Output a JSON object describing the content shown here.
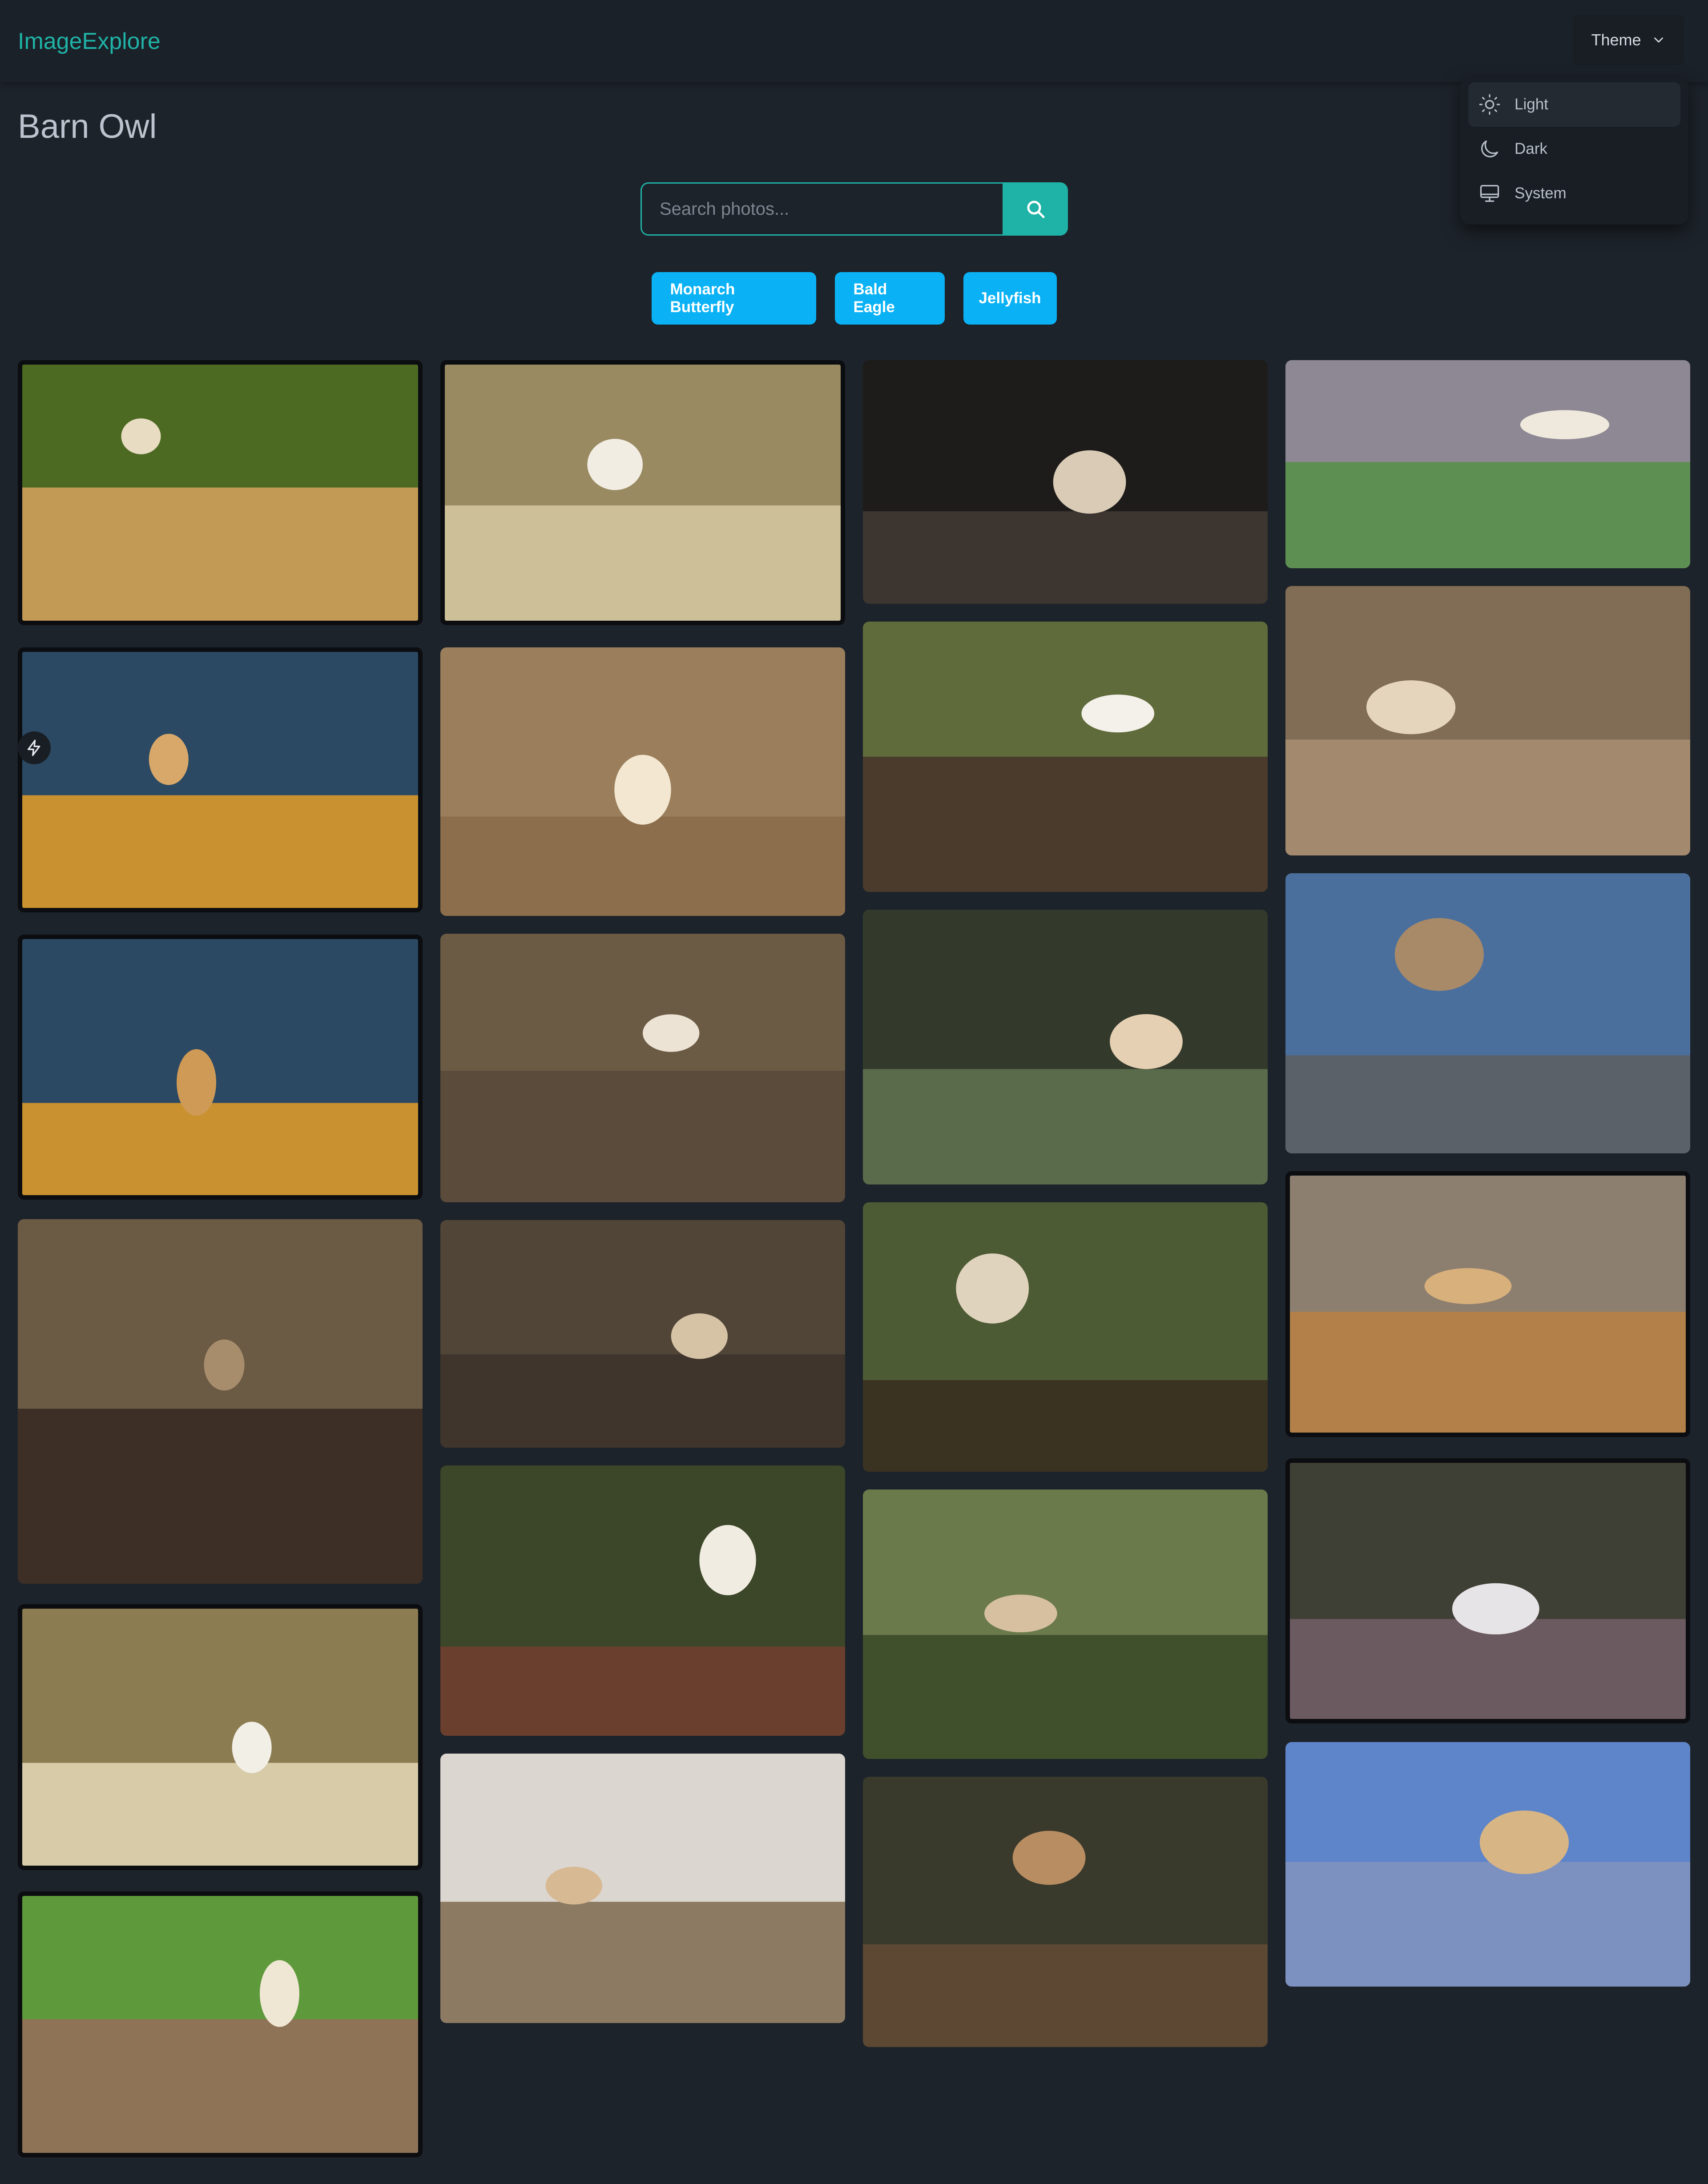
{
  "app": {
    "brand": "ImageExplore"
  },
  "theme_menu": {
    "button_label": "Theme",
    "items": [
      {
        "label": "Light",
        "icon": "sun-icon",
        "active": true
      },
      {
        "label": "Dark",
        "icon": "moon-icon",
        "active": false
      },
      {
        "label": "System",
        "icon": "monitor-icon",
        "active": false
      }
    ]
  },
  "page": {
    "title": "Barn Owl"
  },
  "search": {
    "placeholder": "Search photos...",
    "value": ""
  },
  "suggestions": [
    "Monarch Butterfly",
    "Bald Eagle",
    "Jellyfish"
  ],
  "colors": {
    "background": "#1d232a",
    "brand": "#1fb2a6",
    "tag": "#0ab2f5"
  },
  "gallery": {
    "photos": [
      {
        "subject": "barn-owl-over-golden-field",
        "sky": "#4d6a23",
        "ground": "#c29a55",
        "bird": "#e8dcc3"
      },
      {
        "subject": "barn-owl-over-pale-grass",
        "sky": "#9a8a62",
        "ground": "#cdbf98",
        "bird": "#f1ede3"
      },
      {
        "subject": "two-barn-owls-on-ledge",
        "sky": "#1e1c1b",
        "ground": "#3c3530",
        "bird": "#d9cbb6"
      },
      {
        "subject": "barn-owl-over-green-meadow",
        "sky": "#8d8893",
        "ground": "#5e8f52",
        "bird": "#efe8dc"
      },
      {
        "subject": "barn-owl-against-blue-sky",
        "sky": "#2b4963",
        "ground": "#c9912f",
        "bird": "#d8a86a"
      },
      {
        "subject": "barn-owl-wings-raised",
        "sky": "#9b7f5d",
        "ground": "#8c6e4c",
        "bird": "#f3e7d1"
      },
      {
        "subject": "barn-owl-close-up-perched",
        "sky": "#5f6b3a",
        "ground": "#4b3b2c",
        "bird": "#f4f0ea"
      },
      {
        "subject": "barn-owl-gliding-over-field",
        "sky": "#816c55",
        "ground": "#a38a6e",
        "bird": "#e6d5bd"
      },
      {
        "subject": "barn-owl-in-flight-blue-sky",
        "sky": "#2b4963",
        "ground": "#c9912f",
        "bird": "#cf9a55"
      },
      {
        "subject": "barn-owl-on-wire",
        "sky": "#6b5b45",
        "ground": "#5a4b3a",
        "bird": "#ece3d4"
      },
      {
        "subject": "barn-owl-low-flight-green",
        "sky": "#333a2c",
        "ground": "#5a6b4c",
        "bird": "#e6d0b3"
      },
      {
        "subject": "barred-owl-on-roof",
        "sky": "#4b6f9c",
        "ground": "#5a6168",
        "bird": "#a88a68"
      },
      {
        "subject": "barn-owl-in-autumn-tree",
        "sky": "#6b5a44",
        "ground": "#3d2f26",
        "bird": "#a88d6d"
      },
      {
        "subject": "barn-owl-hidden-in-branches",
        "sky": "#514538",
        "ground": "#3f352c",
        "bird": "#d6c3a6"
      },
      {
        "subject": "barn-owl-among-leaves",
        "sky": "#4d5b35",
        "ground": "#3b3322",
        "bird": "#e0d3be"
      },
      {
        "subject": "barn-owl-over-hedge",
        "sky": "#8c7f70",
        "ground": "#b3804a",
        "bird": "#d8b07c"
      },
      {
        "subject": "barn-owl-over-pale-meadow",
        "sky": "#8c7c52",
        "ground": "#d7cba8",
        "bird": "#f2efe7"
      },
      {
        "subject": "barn-owl-in-bushes",
        "sky": "#3c4628",
        "ground": "#6b3f2e",
        "bird": "#f1ece1"
      },
      {
        "subject": "barn-owl-in-foliage",
        "sky": "#6b7a4b",
        "ground": "#40502c",
        "bird": "#d6c0a0"
      },
      {
        "subject": "barn-owl-over-heath",
        "sky": "#3f4035",
        "ground": "#6b5a5f",
        "bird": "#e7e4e8"
      },
      {
        "subject": "barn-owl-over-green-hedge",
        "sky": "#5e9a3b",
        "ground": "#8e7356",
        "bird": "#efe6d4"
      },
      {
        "subject": "barn-owl-in-misty-field",
        "sky": "#dcd6d0",
        "ground": "#8d7a62",
        "bird": "#d7b993"
      },
      {
        "subject": "barn-owl-sleeping-on-branch",
        "sky": "#3a3a2c",
        "ground": "#5c4833",
        "bird": "#b98d62"
      },
      {
        "subject": "barn-owl-wings-spread-sky",
        "sky": "#5e84c9",
        "ground": "#7c91c0",
        "bird": "#d8b584"
      }
    ]
  }
}
